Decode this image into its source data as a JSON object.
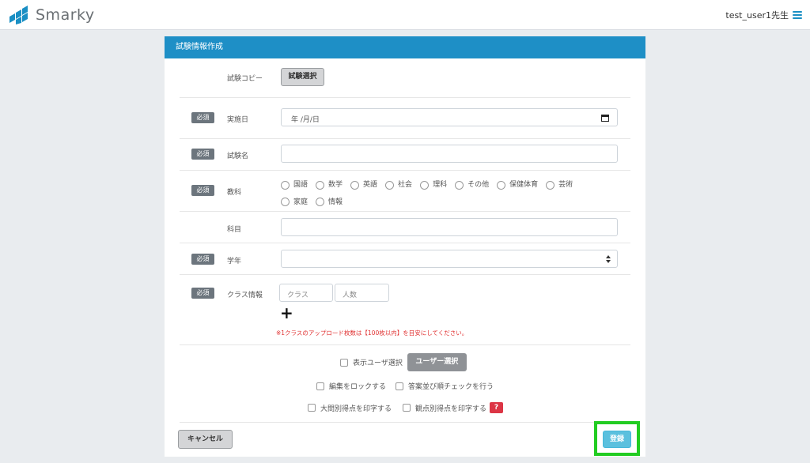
{
  "header": {
    "logo_text": "Smarky",
    "user_label": "test_user1先生"
  },
  "panel": {
    "title": "試験情報作成"
  },
  "form": {
    "copy_label": "試験コピー",
    "copy_button": "試験選択",
    "required_badge": "必須",
    "date_label": "実施日",
    "date_placeholder": "年 /月/日",
    "name_label": "試験名",
    "subject_label": "教科",
    "subjects": [
      "国語",
      "数学",
      "英語",
      "社会",
      "理科",
      "その他",
      "保健体育",
      "芸術",
      "家庭",
      "情報"
    ],
    "course_label": "科目",
    "grade_label": "学年",
    "class_label": "クラス情報",
    "class_placeholder": "クラス",
    "count_placeholder": "人数",
    "add_symbol": "+",
    "note": "※1クラスのアップロード枚数は【100枚以内】を目安にしてください。",
    "show_user_label": "表示ユーザ選択",
    "user_select_button": "ユーザー選択",
    "lock_label": "編集をロックする",
    "answer_check_label": "答案並び順チェックを行う",
    "print_large_label": "大問別得点を印字する",
    "print_view_label": "観点別得点を印字する",
    "help_symbol": "?"
  },
  "footer": {
    "cancel_button": "キャンセル",
    "submit_button": "登録"
  },
  "colors": {
    "accent": "#1e8fc6",
    "submit": "#5bc0de",
    "highlight": "#22cc22",
    "danger": "#dc3545"
  }
}
